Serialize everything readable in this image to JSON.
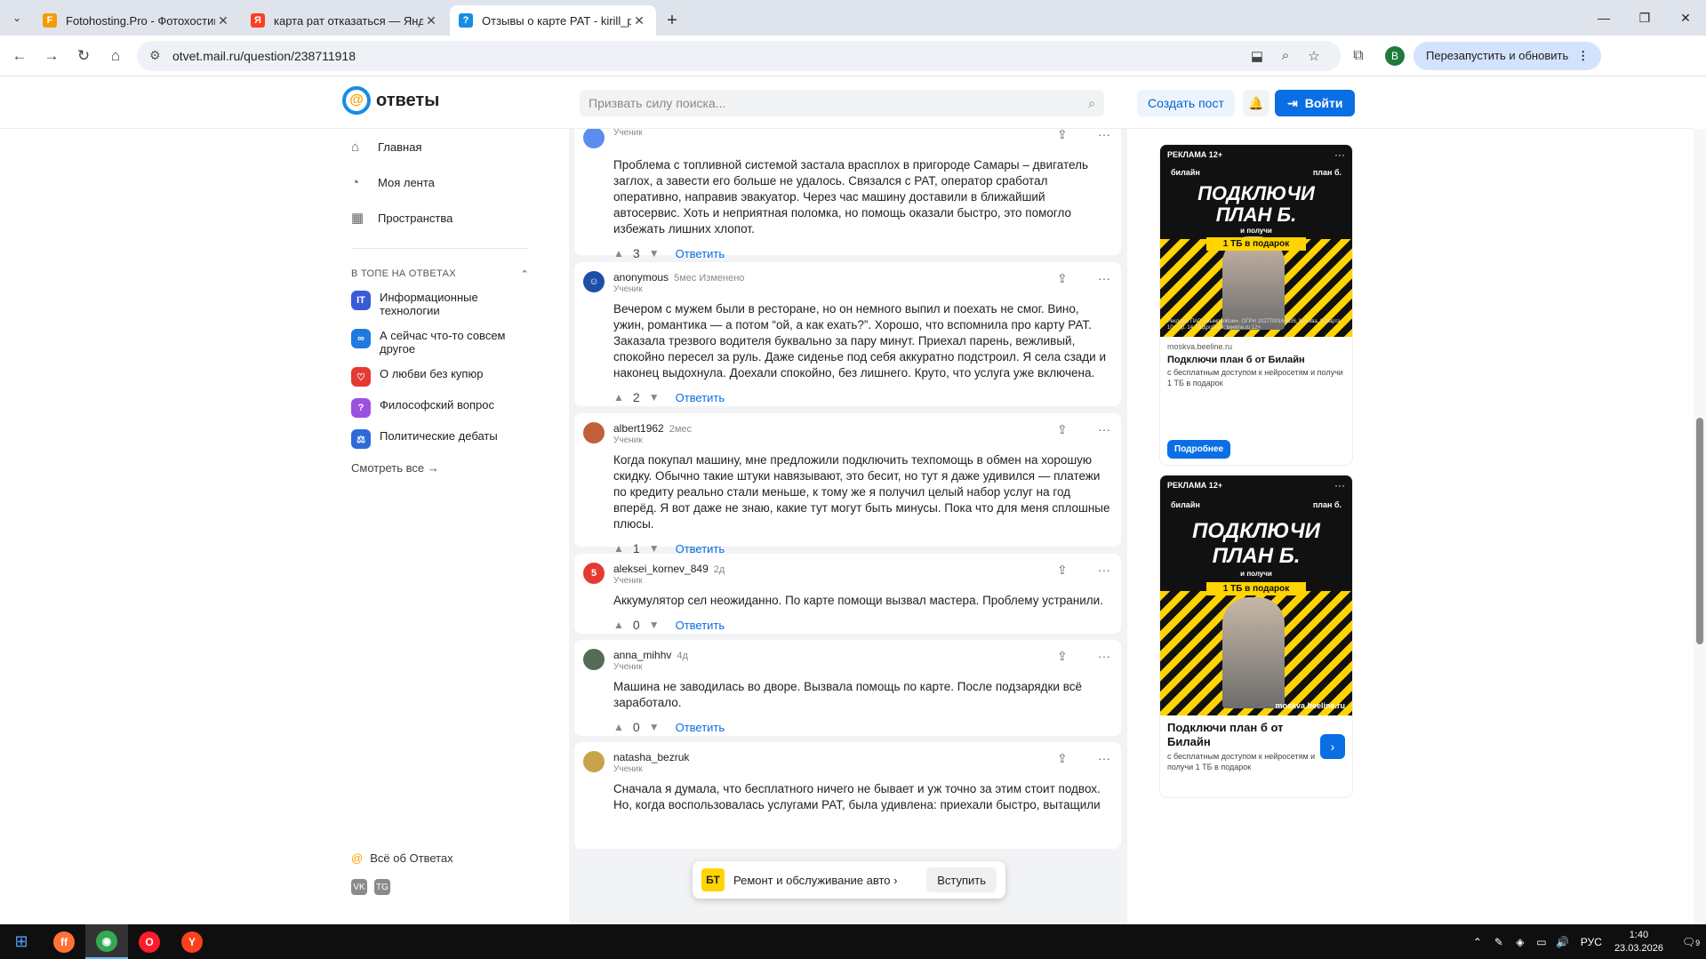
{
  "browser": {
    "tabs": [
      {
        "title": "Fotohosting.Pro - Фотохостинг",
        "fav": "F",
        "fav_color": "#f59b00",
        "active": false
      },
      {
        "title": "карта рат отказаться — Яндекс",
        "fav": "Я",
        "fav_color": "#fc3f1d",
        "active": false
      },
      {
        "title": "Отзывы о карте РАТ - kirill_pet",
        "fav": "?",
        "fav_color": "#168de2",
        "active": true
      }
    ],
    "url": "otvet.mail.ru/question/238711918",
    "profile_letter": "B",
    "relaunch_label": "Перезапустить и обновить"
  },
  "site": {
    "logo_text": "ответы",
    "search_placeholder": "Призвать силу поиска...",
    "create_post": "Создать пост",
    "login": "Войти"
  },
  "sidebar": {
    "nav": [
      {
        "label": "Главная",
        "icon": "home-icon"
      },
      {
        "label": "Моя лента",
        "icon": "feed-icon"
      },
      {
        "label": "Пространства",
        "icon": "spaces-icon"
      }
    ],
    "section_title": "В ТОПЕ НА ОТВЕТАХ",
    "topics": [
      {
        "label": "Информационные технологии",
        "badge": "IT",
        "color": "#3a5bd9"
      },
      {
        "label": "А сейчас что-то совсем другое",
        "badge": "∞",
        "color": "#1f7ae0"
      },
      {
        "label": "О любви без купюр",
        "badge": "♡",
        "color": "#e53935"
      },
      {
        "label": "Философский вопрос",
        "badge": "?",
        "color": "#9b51e0"
      },
      {
        "label": "Политические дебаты",
        "badge": "⚖",
        "color": "#2e6bd9"
      }
    ],
    "see_all": "Смотреть все",
    "about": "Всё об Ответах",
    "social": [
      "VK",
      "TG"
    ]
  },
  "answers": [
    {
      "user": "",
      "meta": "",
      "role": "Ученик",
      "avatar_color": "#5b8def",
      "avatar_letter": "",
      "text": "Проблема с топливной системой застала врасплох в пригороде Самары – двигатель заглох, а завести его больше не удалось. Связался с РАТ, оператор сработал оперативно, направив эвакуатор. Через час машину доставили в ближайший автосервис. Хоть и неприятная поломка, но помощь оказали быстро, это помогло избежать лишних хлопот.",
      "votes": "3",
      "reply": "Ответить"
    },
    {
      "user": "anonymous",
      "meta": "5мес   Изменено",
      "role": "Ученик",
      "avatar_color": "#1e4fa8",
      "avatar_letter": "",
      "text": "Вечером с мужем были в ресторане, но он немного выпил и поехать не смог. Вино, ужин, романтика — а потом “ой, а как ехать?”. Хорошо, что вспомнила про карту РАТ. Заказала трезвого водителя буквально за пару минут. Приехал парень, вежливый, спокойно пересел за руль. Даже сиденье под себя аккуратно подстроил. Я села сзади и наконец выдохнула. Доехали спокойно, без лишнего. Круто, что услуга уже включена.",
      "votes": "2",
      "reply": "Ответить"
    },
    {
      "user": "albert1962",
      "meta": "2мес",
      "role": "Ученик",
      "avatar_color": "#c0603a",
      "avatar_letter": "",
      "text": "Когда покупал машину, мне предложили подключить техпомощь в обмен на хорошую скидку. Обычно такие штуки навязывают, это бесит, но тут я даже удивился — платежи по кредиту реально стали меньше, к тому же я получил целый набор услуг на год вперёд. Я вот даже не знаю, какие тут могут быть минусы. Пока что для меня сплошные плюсы.",
      "votes": "1",
      "reply": "Ответить"
    },
    {
      "user": "aleksei_kornev_849",
      "meta": "2д",
      "role": "Ученик",
      "avatar_color": "#e53935",
      "avatar_letter": "5",
      "text": "Аккумулятор сел неожиданно. По карте помощи вызвал мастера. Проблему устранили.",
      "votes": "0",
      "reply": "Ответить"
    },
    {
      "user": "anna_mihhv",
      "meta": "4д",
      "role": "Ученик",
      "avatar_color": "#556b55",
      "avatar_letter": "",
      "text": "Машина не заводилась во дворе. Вызвала помощь по карте. После подзарядки всё заработало.",
      "votes": "0",
      "reply": "Ответить"
    },
    {
      "user": "natasha_bezruk",
      "meta": "",
      "role": "Ученик",
      "avatar_color": "#c9a34a",
      "avatar_letter": "",
      "text": "Сначала я думала, что бесплатного ничего не бывает и уж точно за этим стоит подвох. Но, когда воспользовалась услугами РАТ, была удивлена: приехали быстро, вытащили",
      "votes": "",
      "reply": ""
    }
  ],
  "community_pill": {
    "label": "Ремонт и обслуживание авто",
    "join": "Вступить"
  },
  "ads": [
    {
      "tag": "РЕКЛАМА 12+",
      "brand": "билайн",
      "plan_tag": "план б.",
      "headline1": "ПОДКЛЮЧИ",
      "headline2": "ПЛАН Б.",
      "sub": "и получи",
      "gift": "1 ТБ в подарок",
      "legal": "Реклама ПАО «ВымпелКом», ОГРН 1027700166636, Москва, 8 Марта, 10, стр. 14. Подробнее: beeline.ru 12+",
      "source": "moskva.beeline.ru",
      "title": "Подключи план б от Билайн",
      "desc": "с бесплатным доступом к нейросетям и получи 1 ТБ в подарок",
      "cta": "Подробнее"
    },
    {
      "tag": "РЕКЛАМА 12+",
      "brand": "билайн",
      "plan_tag": "план б.",
      "headline1": "ПОДКЛЮЧИ",
      "headline2": "ПЛАН Б.",
      "sub": "и получи",
      "gift": "1 ТБ в подарок",
      "domain": "moskva.beeline.ru",
      "title": "Подключи план б от Билайн",
      "desc": "с бесплатным доступом к нейросетям и получи 1 ТБ в подарок"
    }
  ],
  "taskbar": {
    "lang": "РУС",
    "time": "1:40",
    "date": "23.03.2026",
    "notif_count": "9"
  }
}
